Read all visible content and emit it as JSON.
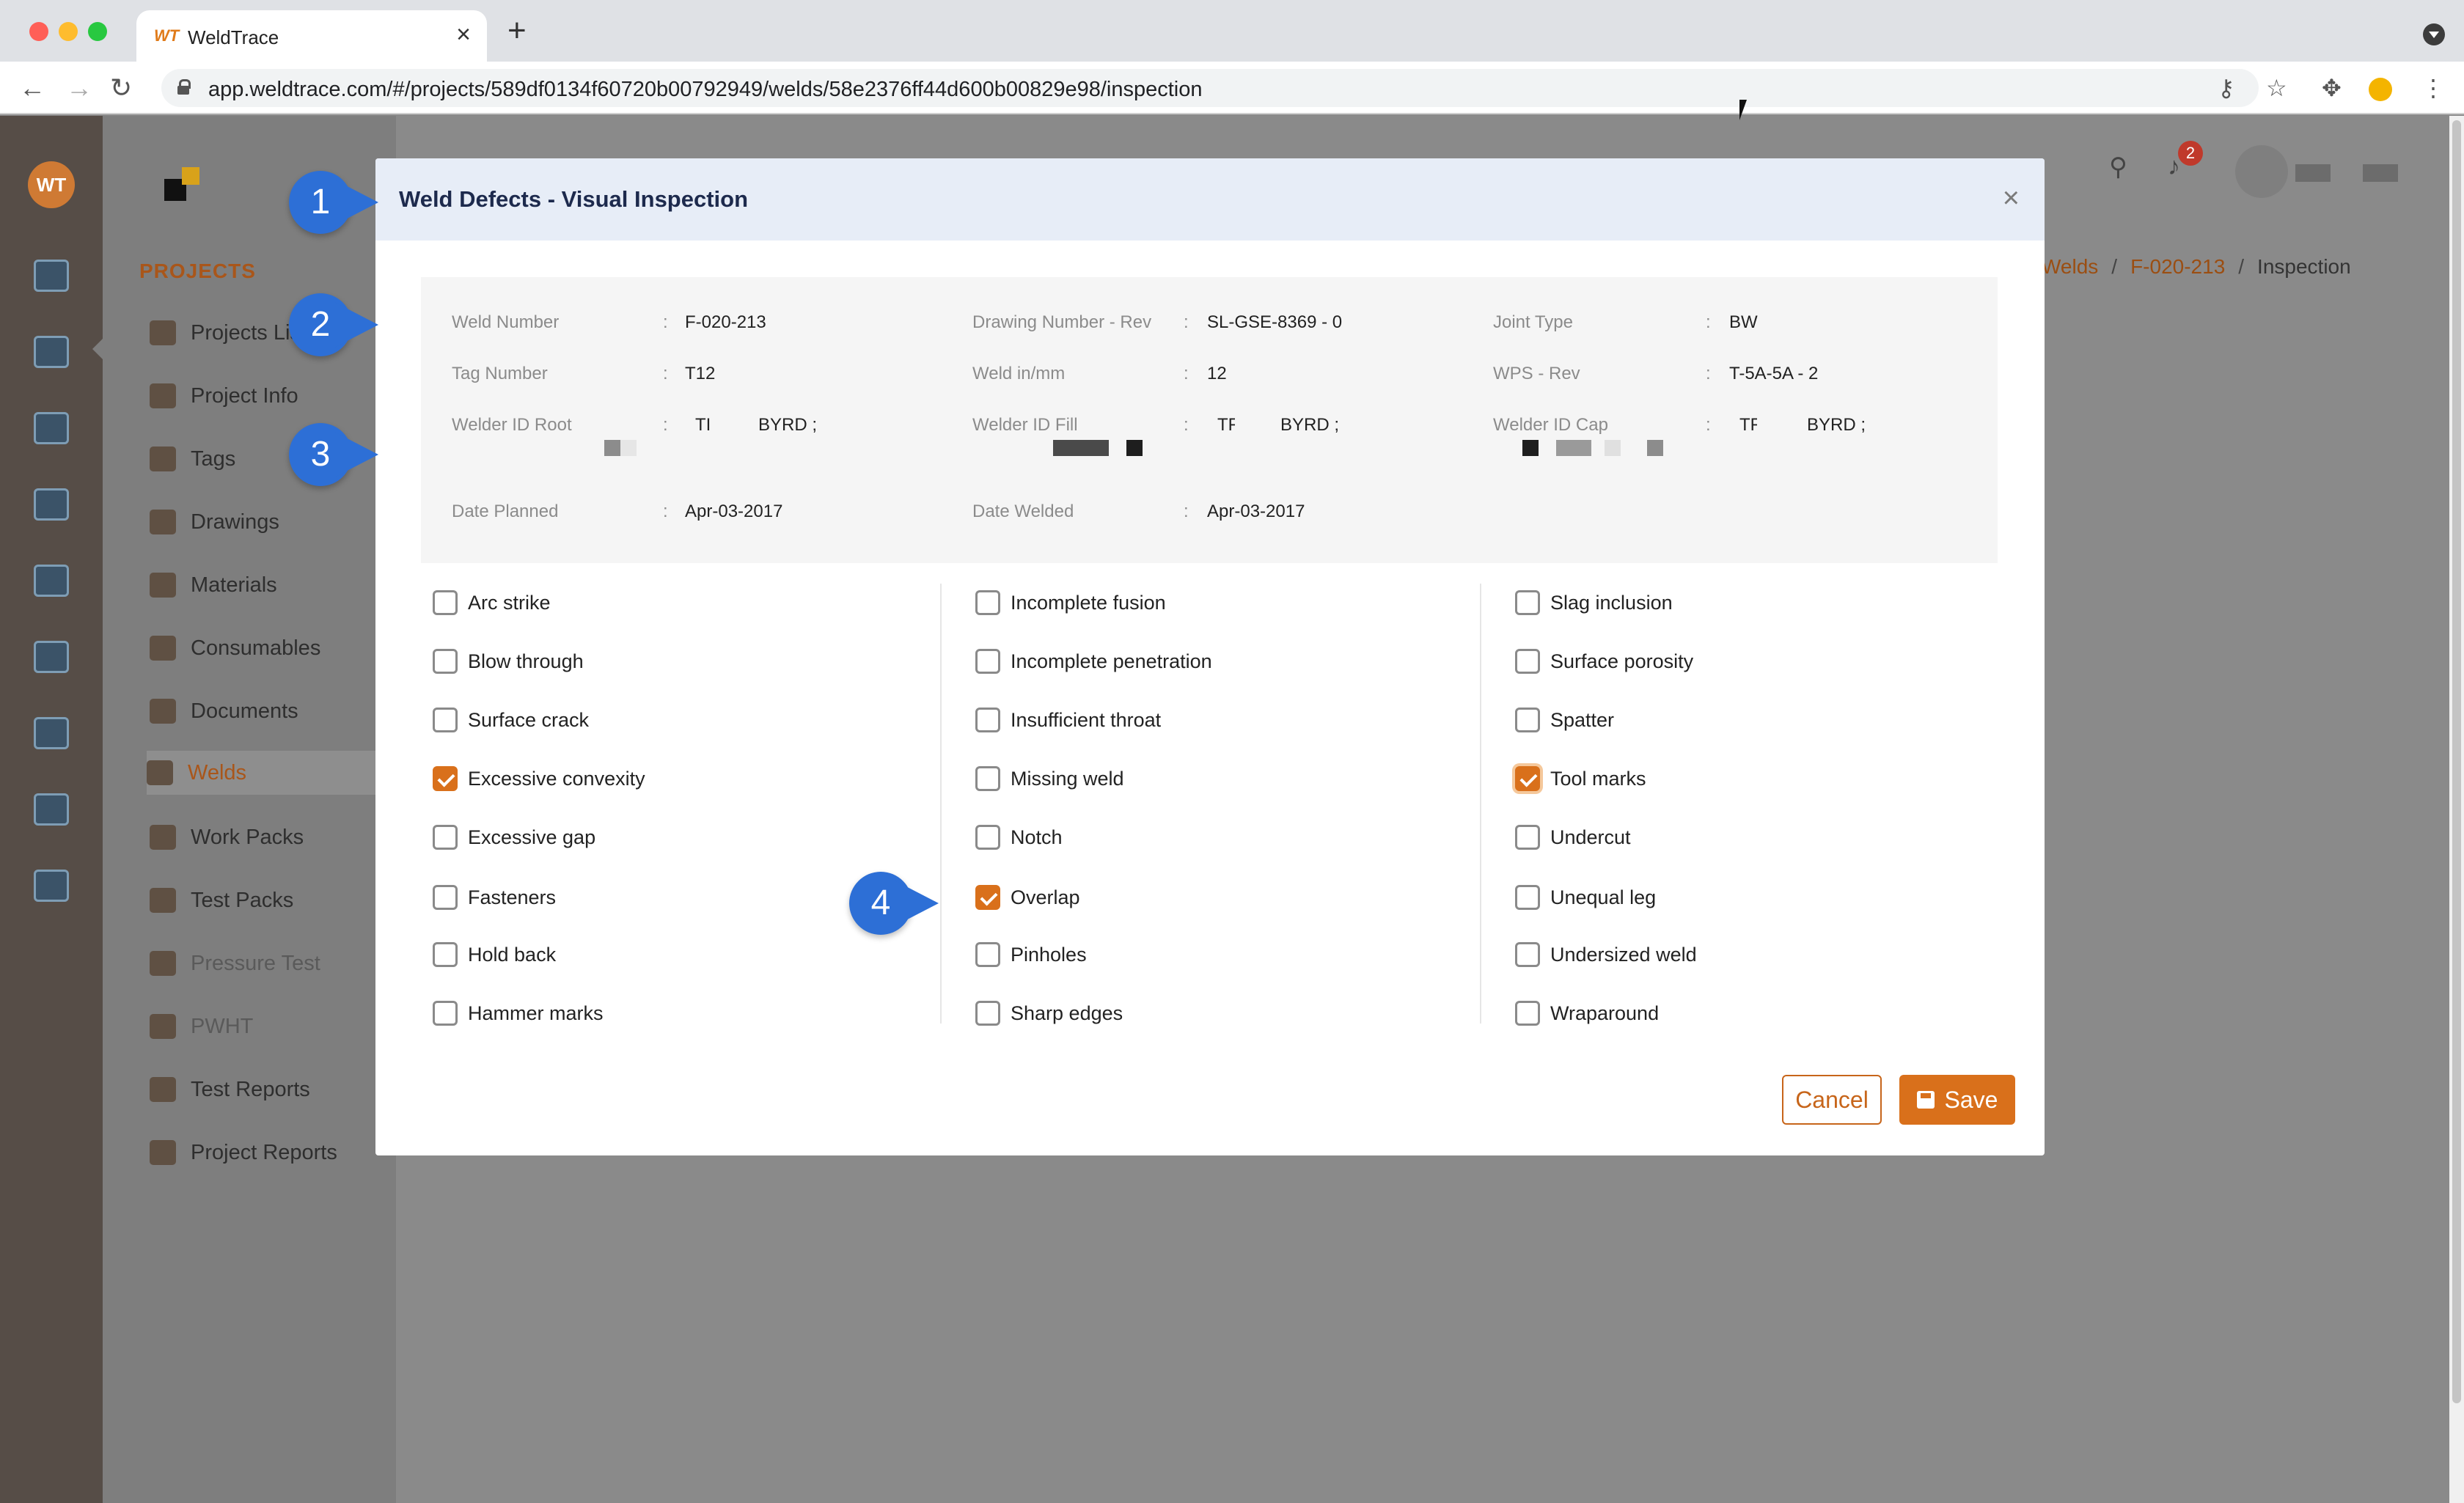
{
  "browser": {
    "tab_title": "WeldTrace",
    "tab_favicon": "WT",
    "url": "app.weldtrace.com/#/projects/589df0134f60720b00792949/welds/58e2376ff44d600b00829e98/inspection"
  },
  "sidebar": {
    "heading": "PROJECTS",
    "items": [
      {
        "label": "Projects List",
        "icon": "projects-icon"
      },
      {
        "label": "Project Info",
        "icon": "project-info-icon"
      },
      {
        "label": "Tags",
        "icon": "tags-icon"
      },
      {
        "label": "Drawings",
        "icon": "drawings-icon"
      },
      {
        "label": "Materials",
        "icon": "materials-icon"
      },
      {
        "label": "Consumables",
        "icon": "consumables-icon"
      },
      {
        "label": "Documents",
        "icon": "documents-icon"
      },
      {
        "label": "Welds",
        "icon": "welds-icon",
        "active": true
      },
      {
        "label": "Work Packs",
        "icon": "work-packs-icon"
      },
      {
        "label": "Test Packs",
        "icon": "test-packs-icon"
      },
      {
        "label": "Pressure Test",
        "icon": "pressure-test-icon",
        "muted": true
      },
      {
        "label": "PWHT",
        "icon": "pwht-icon",
        "muted": true
      },
      {
        "label": "Test Reports",
        "icon": "test-reports-icon"
      },
      {
        "label": "Project Reports",
        "icon": "project-reports-icon"
      }
    ]
  },
  "header": {
    "notification_count": "2",
    "breadcrumb": [
      "Welds",
      "F-020-213",
      "Inspection"
    ]
  },
  "modal": {
    "title": "Weld Defects - Visual Inspection",
    "close": "×",
    "info": {
      "weld_number": {
        "label": "Weld Number",
        "value": "F-020-213"
      },
      "drawing_number": {
        "label": "Drawing Number - Rev",
        "value": "SL-GSE-8369 - 0"
      },
      "joint_type": {
        "label": "Joint Type",
        "value": "BW"
      },
      "tag_number": {
        "label": "Tag Number",
        "value": "T12"
      },
      "weld_in_mm": {
        "label": "Weld in/mm",
        "value": "12"
      },
      "wps_rev": {
        "label": "WPS - Rev",
        "value": "T-5A-5A - 2"
      },
      "welder_root": {
        "label": "Welder ID Root",
        "value_a": "TI",
        "value_b": "BYRD ;"
      },
      "welder_fill": {
        "label": "Welder ID Fill",
        "value_a": "TF",
        "value_b": "BYRD ;"
      },
      "welder_cap": {
        "label": "Welder ID Cap",
        "value_a": "TF",
        "value_b": "BYRD ;"
      },
      "date_planned": {
        "label": "Date Planned",
        "value": "Apr-03-2017"
      },
      "date_welded": {
        "label": "Date Welded",
        "value": "Apr-03-2017"
      },
      "colon": ":"
    },
    "defects": {
      "col1": [
        {
          "label": "Arc strike",
          "checked": false
        },
        {
          "label": "Blow through",
          "checked": false
        },
        {
          "label": "Surface crack",
          "checked": false
        },
        {
          "label": "Excessive convexity",
          "checked": true
        },
        {
          "label": "Excessive gap",
          "checked": false
        },
        {
          "label": "Fasteners",
          "checked": false
        },
        {
          "label": "Hold back",
          "checked": false
        },
        {
          "label": "Hammer marks",
          "checked": false
        }
      ],
      "col2": [
        {
          "label": "Incomplete fusion",
          "checked": false
        },
        {
          "label": "Incomplete penetration",
          "checked": false
        },
        {
          "label": "Insufficient throat",
          "checked": false
        },
        {
          "label": "Missing weld",
          "checked": false
        },
        {
          "label": "Notch",
          "checked": false
        },
        {
          "label": "Overlap",
          "checked": true
        },
        {
          "label": "Pinholes",
          "checked": false
        },
        {
          "label": "Sharp edges",
          "checked": false
        }
      ],
      "col3": [
        {
          "label": "Slag inclusion",
          "checked": false
        },
        {
          "label": "Surface porosity",
          "checked": false
        },
        {
          "label": "Spatter",
          "checked": false
        },
        {
          "label": "Tool marks",
          "checked": true
        },
        {
          "label": "Undercut",
          "checked": false
        },
        {
          "label": "Unequal leg",
          "checked": false
        },
        {
          "label": "Undersized weld",
          "checked": false
        },
        {
          "label": "Wraparound",
          "checked": false
        }
      ]
    },
    "cancel_label": "Cancel",
    "save_label": "Save"
  },
  "callouts": [
    "1",
    "2",
    "3",
    "4"
  ],
  "colors": {
    "accent": "#d9701b",
    "callout": "#2d6fd6",
    "header_bg": "#e7edf7"
  }
}
